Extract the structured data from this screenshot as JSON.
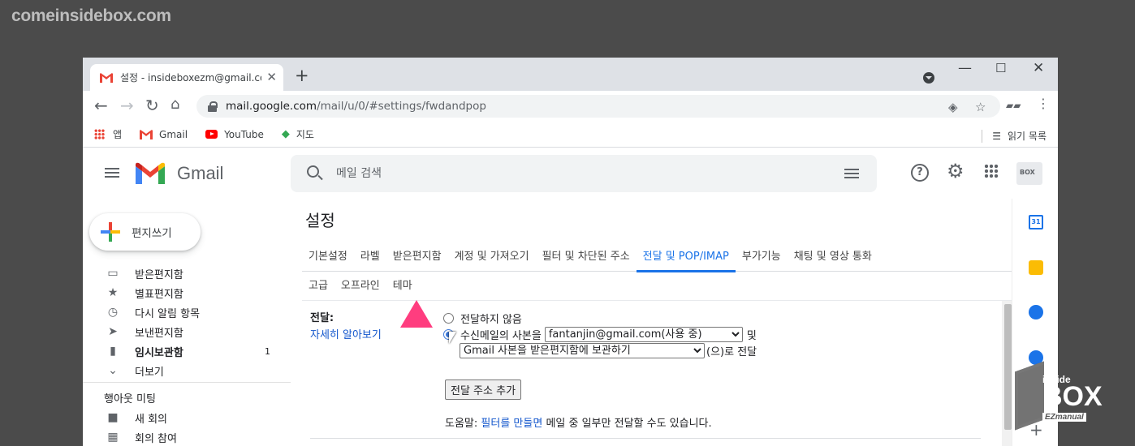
{
  "watermark": {
    "site": "comeinsidebox.com"
  },
  "browser": {
    "tab_title": "설정 - insideboxezm@gmail.com",
    "url_host": "mail.google.com",
    "url_path": "/mail/u/0/#settings/fwdandpop",
    "bookmarks": [
      "앱",
      "Gmail",
      "YouTube",
      "지도"
    ],
    "reading_list": "읽기 목록"
  },
  "gmail": {
    "brand": "Gmail",
    "search_placeholder": "메일 검색",
    "compose": "편지쓰기",
    "nav": [
      {
        "label": "받은편지함",
        "icon": "inbox-icon"
      },
      {
        "label": "별표편지함",
        "icon": "star-icon"
      },
      {
        "label": "다시 알림 항목",
        "icon": "clock-icon"
      },
      {
        "label": "보낸편지함",
        "icon": "send-icon"
      },
      {
        "label": "임시보관함",
        "icon": "draft-icon",
        "count": "1"
      },
      {
        "label": "더보기",
        "icon": "chevron-down-icon"
      }
    ],
    "meet_title": "행아웃 미팅",
    "meet": [
      {
        "label": "새 회의",
        "icon": "video-icon"
      },
      {
        "label": "회의 참여",
        "icon": "keyboard-icon"
      }
    ]
  },
  "settings": {
    "title": "설정",
    "tabs_row1": [
      "기본설정",
      "라벨",
      "받은편지함",
      "계정 및 가져오기",
      "필터 및 차단된 주소",
      "전달 및 POP/IMAP",
      "부가기능",
      "채팅 및 영상 통화"
    ],
    "tabs_row2": [
      "고급",
      "오프라인",
      "테마"
    ],
    "active_tab": "전달 및 POP/IMAP",
    "forwarding": {
      "label": "전달:",
      "learn_more": "자세히 알아보기",
      "option_off": "전달하지 않음",
      "option_on": "수신메일의 사본을",
      "address": "fantanjin@gmail.com(사용 중)",
      "and": "및",
      "action": "Gmail 사본을 받은편지함에 보관하기",
      "suffix": "(으)로 전달",
      "add_button": "전달 주소 추가",
      "help_prefix": "도움말:",
      "help_link": "필터를 만들면",
      "help_suffix": "메일 중 일부만 전달할 수도 있습니다."
    }
  },
  "logo": {
    "inside": "inside",
    "box": "BOX",
    "ez": "EZmanual"
  },
  "side_panel": {
    "calendar_day": "31"
  }
}
